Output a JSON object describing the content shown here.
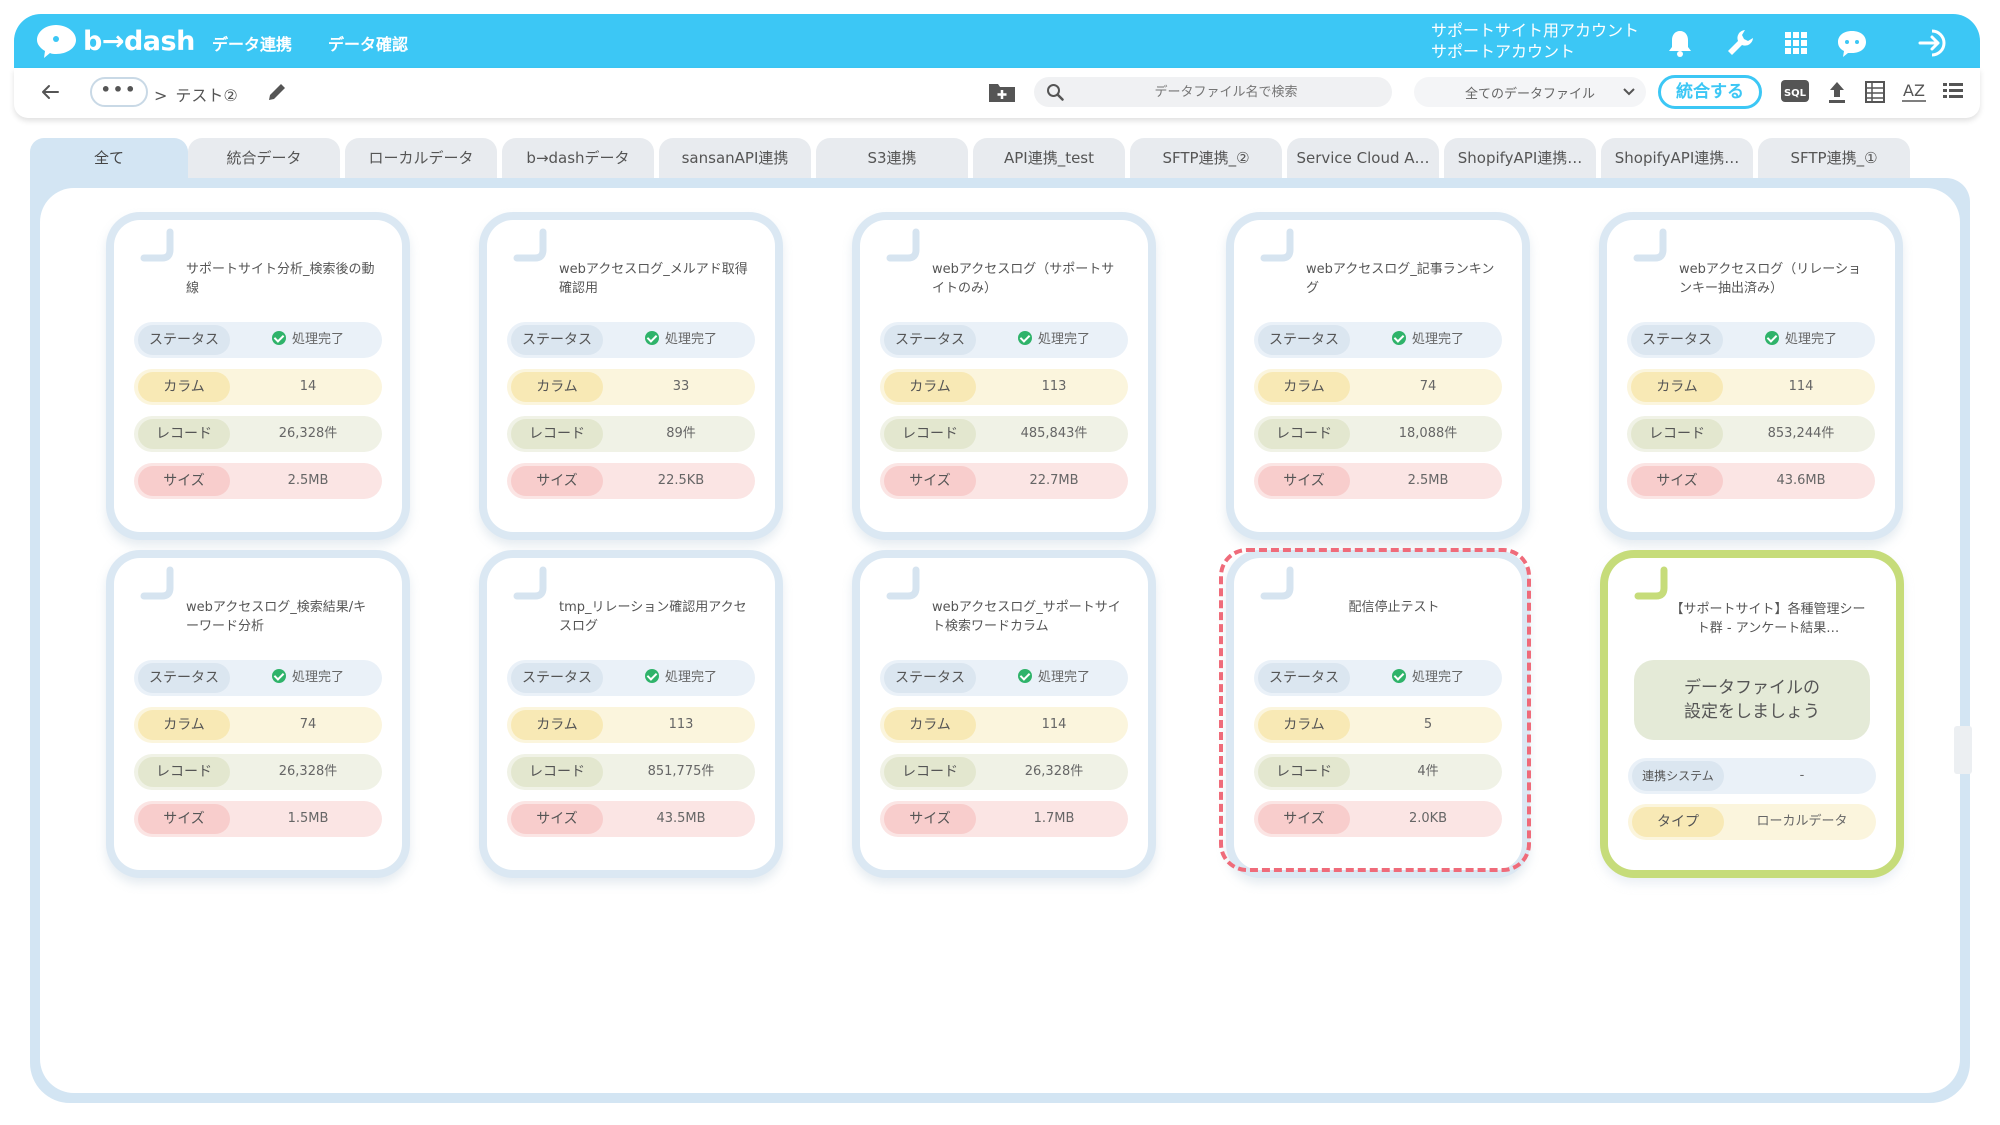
{
  "app": {
    "logo_text": "b→dash"
  },
  "nav": [
    {
      "label": "データ連携"
    },
    {
      "label": "データ確認"
    }
  ],
  "account": {
    "line1": "サポートサイト用アカウント",
    "line2": "サポートアカウント"
  },
  "toolbar": {
    "more_label": "•••",
    "breadcrumb_sep": ">",
    "breadcrumb": "テスト②",
    "search_placeholder": "データファイル名で検索",
    "filter_value": "全てのデータファイル",
    "merge_label": "統合する",
    "sql_label": "SQL",
    "sort_label": "AZ"
  },
  "tabs": [
    {
      "label": "全て"
    },
    {
      "label": "統合データ"
    },
    {
      "label": "ローカルデータ"
    },
    {
      "label": "b→dashデータ"
    },
    {
      "label": "sansanAPI連携"
    },
    {
      "label": "S3連携"
    },
    {
      "label": "API連携_test"
    },
    {
      "label": "SFTP連携_②"
    },
    {
      "label": "Service Cloud A…"
    },
    {
      "label": "ShopifyAPI連携…"
    },
    {
      "label": "ShopifyAPI連携…"
    },
    {
      "label": "SFTP連携_①"
    }
  ],
  "labels": {
    "status": "ステータス",
    "columns": "カラム",
    "records": "レコード",
    "size": "サイズ"
  },
  "cards": [
    {
      "title": "サポートサイト分析_検索後の動線",
      "status": "処理完了",
      "columns": "14",
      "records": "26,328件",
      "size": "2.5MB"
    },
    {
      "title": "webアクセスログ_メルアド取得確認用",
      "status": "処理完了",
      "columns": "33",
      "records": "89件",
      "size": "22.5KB"
    },
    {
      "title": "webアクセスログ（サポートサイトのみ）",
      "status": "処理完了",
      "columns": "113",
      "records": "485,843件",
      "size": "22.7MB"
    },
    {
      "title": "webアクセスログ_記事ランキング",
      "status": "処理完了",
      "columns": "74",
      "records": "18,088件",
      "size": "2.5MB"
    },
    {
      "title": "webアクセスログ（リレーションキー抽出済み）",
      "status": "処理完了",
      "columns": "114",
      "records": "853,244件",
      "size": "43.6MB"
    },
    {
      "title": "webアクセスログ_検索結果/キーワード分析",
      "status": "処理完了",
      "columns": "74",
      "records": "26,328件",
      "size": "1.5MB"
    },
    {
      "title": "tmp_リレーション確認用アクセスログ",
      "status": "処理完了",
      "columns": "113",
      "records": "851,775件",
      "size": "43.5MB"
    },
    {
      "title": "webアクセスログ_サポートサイト検索ワードカラム",
      "status": "処理完了",
      "columns": "114",
      "records": "26,328件",
      "size": "1.7MB"
    },
    {
      "title": "配信停止テスト",
      "status": "処理完了",
      "columns": "5",
      "records": "4件",
      "size": "2.0KB"
    }
  ],
  "setup_card": {
    "title": "【サポートサイト】各種管理シート群 - アンケート結果…",
    "message_line1": "データファイルの",
    "message_line2": "設定をしましょう",
    "system_label": "連携システム",
    "system_value": "-",
    "type_label": "タイプ",
    "type_value": "ローカルデータ"
  },
  "colors": {
    "brand": "#3cc7f5",
    "highlight": "#ef6b7a",
    "success": "#2fb36a"
  }
}
